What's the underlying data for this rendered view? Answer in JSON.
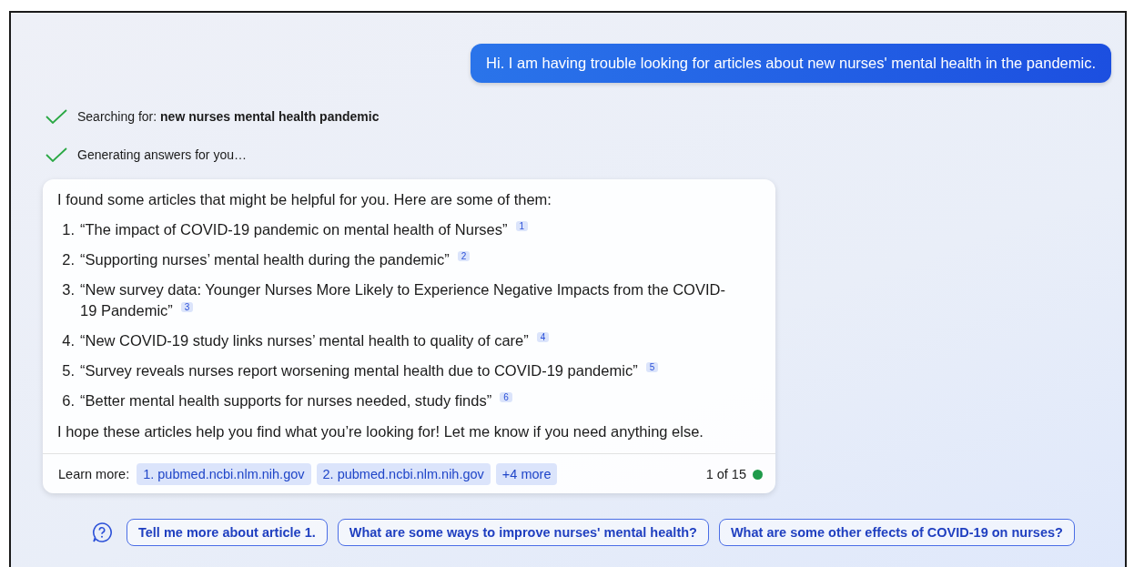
{
  "user_message": "Hi. I am having trouble looking for articles about new nurses' mental health in the pandemic.",
  "progress": [
    {
      "label": "Searching for: ",
      "query": "new nurses mental health pandemic",
      "done": true
    },
    {
      "label": "Generating answers for you…",
      "done": true
    }
  ],
  "answer": {
    "intro": "I found some articles that might be helpful for you. Here are some of them:",
    "articles": [
      {
        "number": "1.",
        "title": "“The impact of COVID-19 pandemic on mental health of Nurses”",
        "citation": "1"
      },
      {
        "number": "2.",
        "title": "“Supporting nurses’ mental health during the pandemic”",
        "citation": "2"
      },
      {
        "number": "3.",
        "title": "“New survey data: Younger Nurses More Likely to Experience Negative Impacts from the COVID-19 Pandemic”",
        "citation": "3"
      },
      {
        "number": "4.",
        "title": "“New COVID-19 study links nurses’ mental health to quality of care”",
        "citation": "4"
      },
      {
        "number": "5.",
        "title": "“Survey reveals nurses report worsening mental health due to COVID-19 pandemic”",
        "citation": "5"
      },
      {
        "number": "6.",
        "title": "“Better mental health supports for nurses needed, study finds”",
        "citation": "6"
      }
    ],
    "outro": "I hope these articles help you find what you’re looking for! Let me know if you need anything else.",
    "learn_more_label": "Learn more:",
    "sources": [
      "1. pubmed.ncbi.nlm.nih.gov",
      "2. pubmed.ncbi.nlm.nih.gov",
      "+4 more"
    ],
    "turn_counter": "1 of 15"
  },
  "suggestions": [
    "Tell me more about article 1.",
    "What are some ways to improve nurses' mental health?",
    "What are some other effects of COVID-19 on nurses?"
  ]
}
